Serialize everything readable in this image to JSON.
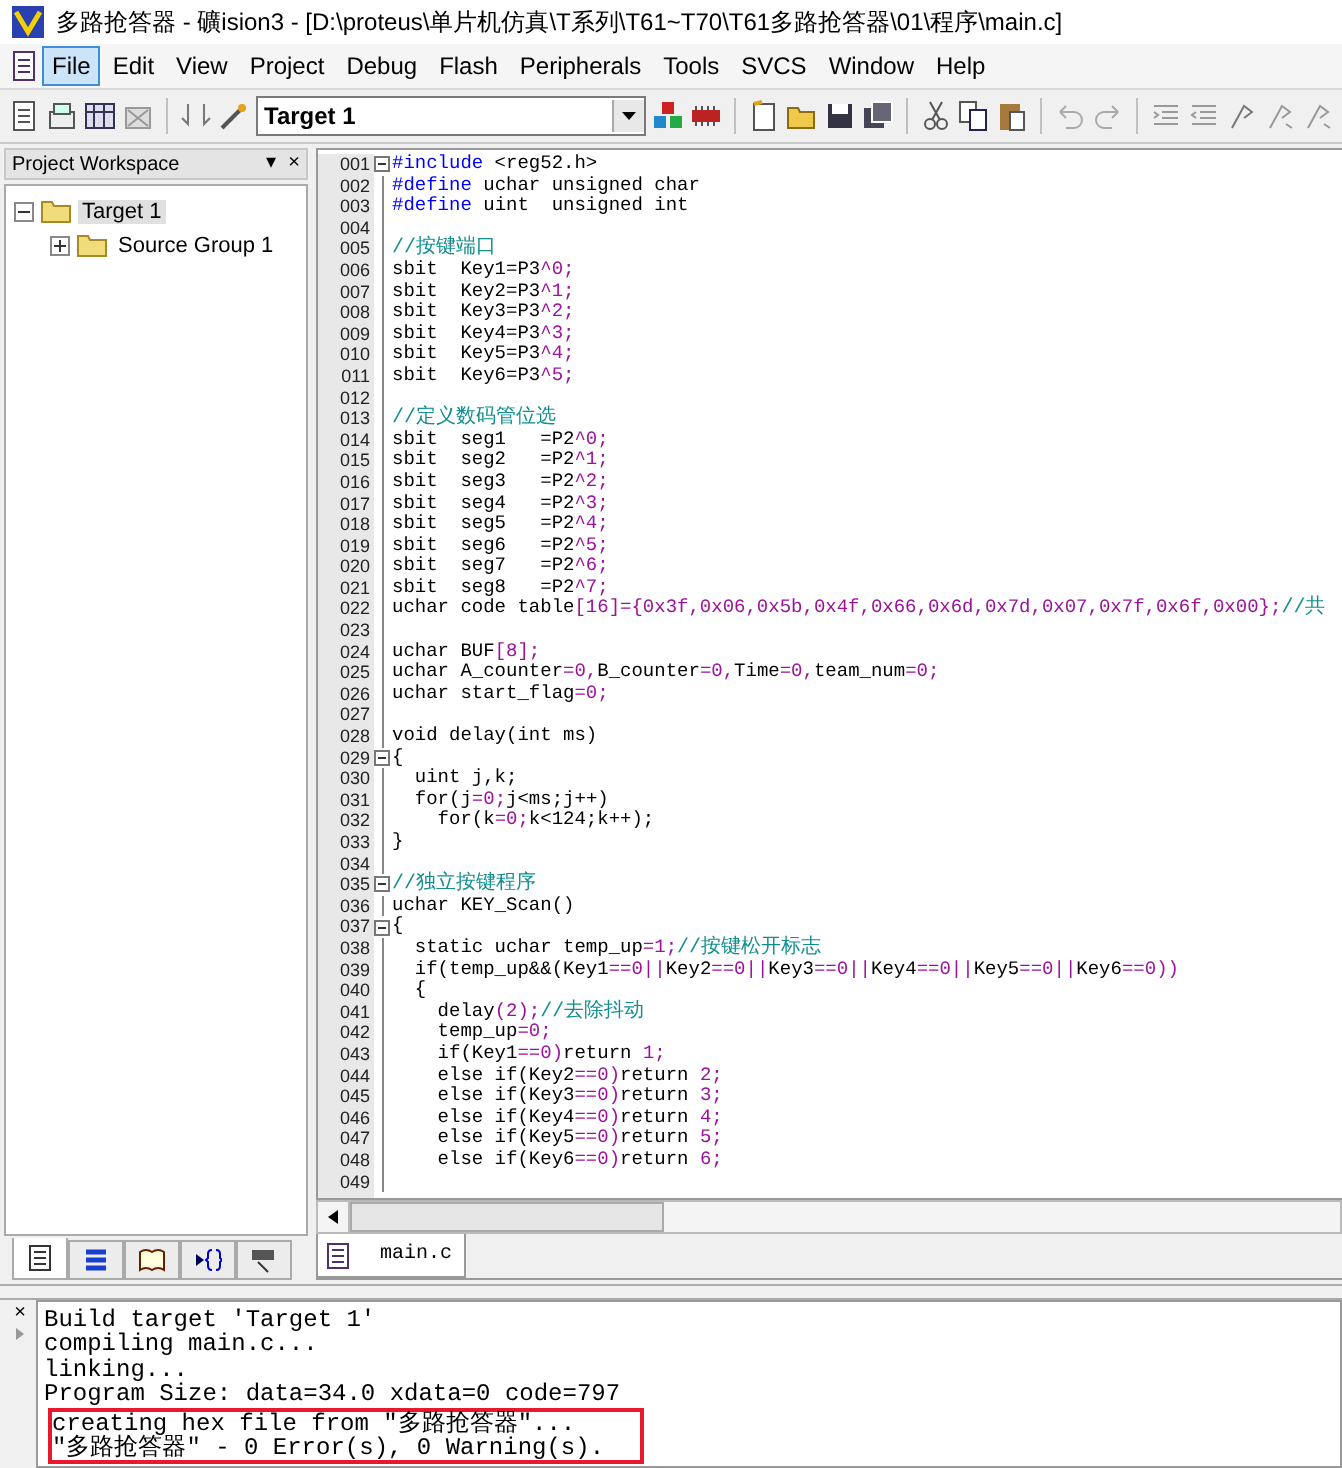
{
  "window": {
    "title": "多路抢答器  - 礦ision3 - [D:\\proteus\\单片机仿真\\T系列\\T61~T70\\T61多路抢答器\\01\\程序\\main.c]"
  },
  "menu": [
    {
      "label": "File",
      "selected": true
    },
    {
      "label": "Edit",
      "selected": false
    },
    {
      "label": "View",
      "selected": false
    },
    {
      "label": "Project",
      "selected": false
    },
    {
      "label": "Debug",
      "selected": false
    },
    {
      "label": "Flash",
      "selected": false
    },
    {
      "label": "Peripherals",
      "selected": false
    },
    {
      "label": "Tools",
      "selected": false
    },
    {
      "label": "SVCS",
      "selected": false
    },
    {
      "label": "Window",
      "selected": false
    },
    {
      "label": "Help",
      "selected": false
    }
  ],
  "toolbar": {
    "target": "Target 1"
  },
  "workspace": {
    "title": "Project Workspace",
    "menu_glyph": "▾",
    "close_glyph": "×",
    "tree": [
      {
        "label": "Target 1",
        "selected": true,
        "expanded": true,
        "children": [
          {
            "label": "Source Group 1",
            "selected": false,
            "expanded": false
          }
        ]
      }
    ],
    "tabs": [
      {
        "selected": true
      },
      {
        "selected": false
      },
      {
        "selected": false
      },
      {
        "selected": false
      },
      {
        "selected": false
      }
    ]
  },
  "editor": {
    "lines": [
      {
        "n": "001",
        "fold": true,
        "segs": [
          {
            "text": "#include",
            "kind": "kw"
          },
          {
            "text": " <reg52.h>",
            "kind": "plain"
          }
        ]
      },
      {
        "n": "002",
        "fold": false,
        "segs": [
          {
            "text": "#define",
            "kind": "kw"
          },
          {
            "text": " uchar unsigned char",
            "kind": "plain"
          }
        ]
      },
      {
        "n": "003",
        "fold": false,
        "segs": [
          {
            "text": "#define",
            "kind": "kw"
          },
          {
            "text": " uint  unsigned int",
            "kind": "plain"
          }
        ]
      },
      {
        "n": "004",
        "fold": false
      },
      {
        "n": "005",
        "fold": false,
        "segs": [
          {
            "text": "//按键端口",
            "kind": "comment"
          }
        ]
      },
      {
        "n": "006",
        "fold": false,
        "segs": [
          {
            "text": "sbit  Key1=P3",
            "kind": "plain"
          },
          {
            "text": "^0;",
            "kind": "num"
          }
        ]
      },
      {
        "n": "007",
        "fold": false,
        "segs": [
          {
            "text": "sbit  Key2=P3",
            "kind": "plain"
          },
          {
            "text": "^1;",
            "kind": "num"
          }
        ]
      },
      {
        "n": "008",
        "fold": false,
        "segs": [
          {
            "text": "sbit  Key3=P3",
            "kind": "plain"
          },
          {
            "text": "^2;",
            "kind": "num"
          }
        ]
      },
      {
        "n": "009",
        "fold": false,
        "segs": [
          {
            "text": "sbit  Key4=P3",
            "kind": "plain"
          },
          {
            "text": "^3;",
            "kind": "num"
          }
        ]
      },
      {
        "n": "010",
        "fold": false,
        "segs": [
          {
            "text": "sbit  Key5=P3",
            "kind": "plain"
          },
          {
            "text": "^4;",
            "kind": "num"
          }
        ]
      },
      {
        "n": "011",
        "fold": false,
        "segs": [
          {
            "text": "sbit  Key6=P3",
            "kind": "plain"
          },
          {
            "text": "^5;",
            "kind": "num"
          }
        ]
      },
      {
        "n": "012",
        "fold": false
      },
      {
        "n": "013",
        "fold": false,
        "segs": [
          {
            "text": "//定义数码管位选",
            "kind": "comment"
          }
        ]
      },
      {
        "n": "014",
        "fold": false,
        "segs": [
          {
            "text": "sbit  seg1   =P2",
            "kind": "plain"
          },
          {
            "text": "^0;",
            "kind": "num"
          }
        ]
      },
      {
        "n": "015",
        "fold": false,
        "segs": [
          {
            "text": "sbit  seg2   =P2",
            "kind": "plain"
          },
          {
            "text": "^1;",
            "kind": "num"
          }
        ]
      },
      {
        "n": "016",
        "fold": false,
        "segs": [
          {
            "text": "sbit  seg3   =P2",
            "kind": "plain"
          },
          {
            "text": "^2;",
            "kind": "num"
          }
        ]
      },
      {
        "n": "017",
        "fold": false,
        "segs": [
          {
            "text": "sbit  seg4   =P2",
            "kind": "plain"
          },
          {
            "text": "^3;",
            "kind": "num"
          }
        ]
      },
      {
        "n": "018",
        "fold": false,
        "segs": [
          {
            "text": "sbit  seg5   =P2",
            "kind": "plain"
          },
          {
            "text": "^4;",
            "kind": "num"
          }
        ]
      },
      {
        "n": "019",
        "fold": false,
        "segs": [
          {
            "text": "sbit  seg6   =P2",
            "kind": "plain"
          },
          {
            "text": "^5;",
            "kind": "num"
          }
        ]
      },
      {
        "n": "020",
        "fold": false,
        "segs": [
          {
            "text": "sbit  seg7   =P2",
            "kind": "plain"
          },
          {
            "text": "^6;",
            "kind": "num"
          }
        ]
      },
      {
        "n": "021",
        "fold": false,
        "segs": [
          {
            "text": "sbit  seg8   =P2",
            "kind": "plain"
          },
          {
            "text": "^7;",
            "kind": "num"
          }
        ]
      },
      {
        "n": "022",
        "fold": false,
        "segs": [
          {
            "text": "uchar code table",
            "kind": "plain"
          },
          {
            "text": "[16]={0x3f,0x06,0x5b,0x4f,0x66,0x6d,0x7d,0x07,0x7f,0x6f,0x00};",
            "kind": "num"
          },
          {
            "text": "//共",
            "kind": "comment"
          }
        ]
      },
      {
        "n": "023",
        "fold": false
      },
      {
        "n": "024",
        "fold": false,
        "segs": [
          {
            "text": "uchar BUF",
            "kind": "plain"
          },
          {
            "text": "[8];",
            "kind": "num"
          }
        ]
      },
      {
        "n": "025",
        "fold": false,
        "segs": [
          {
            "text": "uchar A_counter",
            "kind": "plain"
          },
          {
            "text": "=0,",
            "kind": "num"
          },
          {
            "text": "B_counter",
            "kind": "plain"
          },
          {
            "text": "=0,",
            "kind": "num"
          },
          {
            "text": "Time",
            "kind": "plain"
          },
          {
            "text": "=0,",
            "kind": "num"
          },
          {
            "text": "team_num",
            "kind": "plain"
          },
          {
            "text": "=0;",
            "kind": "num"
          }
        ]
      },
      {
        "n": "026",
        "fold": false,
        "segs": [
          {
            "text": "uchar start_flag",
            "kind": "plain"
          },
          {
            "text": "=0;",
            "kind": "num"
          }
        ]
      },
      {
        "n": "027",
        "fold": false
      },
      {
        "n": "028",
        "fold": false,
        "segs": [
          {
            "text": "void delay(int ms)",
            "kind": "plain"
          }
        ]
      },
      {
        "n": "029",
        "fold": true,
        "segs": [
          {
            "text": "{",
            "kind": "plain"
          }
        ]
      },
      {
        "n": "030",
        "fold": false,
        "segs": [
          {
            "text": "  uint j,k;",
            "kind": "plain"
          }
        ]
      },
      {
        "n": "031",
        "fold": false,
        "segs": [
          {
            "text": "  for(j",
            "kind": "plain"
          },
          {
            "text": "=0;",
            "kind": "num"
          },
          {
            "text": "j<ms;j++)",
            "kind": "plain"
          }
        ]
      },
      {
        "n": "032",
        "fold": false,
        "segs": [
          {
            "text": "    for(k",
            "kind": "plain"
          },
          {
            "text": "=0;",
            "kind": "num"
          },
          {
            "text": "k<124;k++);",
            "kind": "plain"
          }
        ]
      },
      {
        "n": "033",
        "fold": false,
        "segs": [
          {
            "text": "}",
            "kind": "plain"
          }
        ]
      },
      {
        "n": "034",
        "fold": false
      },
      {
        "n": "035",
        "fold": true,
        "segs": [
          {
            "text": "//独立按键程序",
            "kind": "comment"
          }
        ]
      },
      {
        "n": "036",
        "fold": false,
        "segs": [
          {
            "text": "uchar KEY_Scan()",
            "kind": "plain"
          }
        ]
      },
      {
        "n": "037",
        "fold": true,
        "segs": [
          {
            "text": "{",
            "kind": "plain"
          }
        ]
      },
      {
        "n": "038",
        "fold": false,
        "segs": [
          {
            "text": "  static uchar temp_up",
            "kind": "plain"
          },
          {
            "text": "=1;",
            "kind": "num"
          },
          {
            "text": "//按键松开标志",
            "kind": "comment"
          }
        ]
      },
      {
        "n": "039",
        "fold": false,
        "segs": [
          {
            "text": "  if(temp_up&&(Key1",
            "kind": "plain"
          },
          {
            "text": "==0||",
            "kind": "num"
          },
          {
            "text": "Key2",
            "kind": "plain"
          },
          {
            "text": "==0||",
            "kind": "num"
          },
          {
            "text": "Key3",
            "kind": "plain"
          },
          {
            "text": "==0||",
            "kind": "num"
          },
          {
            "text": "Key4",
            "kind": "plain"
          },
          {
            "text": "==0||",
            "kind": "num"
          },
          {
            "text": "Key5",
            "kind": "plain"
          },
          {
            "text": "==0||",
            "kind": "num"
          },
          {
            "text": "Key6",
            "kind": "plain"
          },
          {
            "text": "==0))",
            "kind": "num"
          }
        ]
      },
      {
        "n": "040",
        "fold": false,
        "segs": [
          {
            "text": "  {",
            "kind": "plain"
          }
        ]
      },
      {
        "n": "041",
        "fold": false,
        "segs": [
          {
            "text": "    delay",
            "kind": "plain"
          },
          {
            "text": "(2);",
            "kind": "num"
          },
          {
            "text": "//去除抖动",
            "kind": "comment"
          }
        ]
      },
      {
        "n": "042",
        "fold": false,
        "segs": [
          {
            "text": "    temp_up",
            "kind": "plain"
          },
          {
            "text": "=0;",
            "kind": "num"
          }
        ]
      },
      {
        "n": "043",
        "fold": false,
        "segs": [
          {
            "text": "    if(Key1",
            "kind": "plain"
          },
          {
            "text": "==0)",
            "kind": "num"
          },
          {
            "text": "return ",
            "kind": "plain"
          },
          {
            "text": "1;",
            "kind": "num"
          }
        ]
      },
      {
        "n": "044",
        "fold": false,
        "segs": [
          {
            "text": "    else if(Key2",
            "kind": "plain"
          },
          {
            "text": "==0)",
            "kind": "num"
          },
          {
            "text": "return ",
            "kind": "plain"
          },
          {
            "text": "2;",
            "kind": "num"
          }
        ]
      },
      {
        "n": "045",
        "fold": false,
        "segs": [
          {
            "text": "    else if(Key3",
            "kind": "plain"
          },
          {
            "text": "==0)",
            "kind": "num"
          },
          {
            "text": "return ",
            "kind": "plain"
          },
          {
            "text": "3;",
            "kind": "num"
          }
        ]
      },
      {
        "n": "046",
        "fold": false,
        "segs": [
          {
            "text": "    else if(Key4",
            "kind": "plain"
          },
          {
            "text": "==0)",
            "kind": "num"
          },
          {
            "text": "return ",
            "kind": "plain"
          },
          {
            "text": "4;",
            "kind": "num"
          }
        ]
      },
      {
        "n": "047",
        "fold": false,
        "segs": [
          {
            "text": "    else if(Key5",
            "kind": "plain"
          },
          {
            "text": "==0)",
            "kind": "num"
          },
          {
            "text": "return ",
            "kind": "plain"
          },
          {
            "text": "5;",
            "kind": "num"
          }
        ]
      },
      {
        "n": "048",
        "fold": false,
        "segs": [
          {
            "text": "    else if(Key6",
            "kind": "plain"
          },
          {
            "text": "==0)",
            "kind": "num"
          },
          {
            "text": "return ",
            "kind": "plain"
          },
          {
            "text": "6;",
            "kind": "num"
          }
        ]
      },
      {
        "n": "049",
        "fold": false
      }
    ],
    "tabs": [
      {
        "label": "main.c",
        "selected": true
      }
    ]
  },
  "output": {
    "close_glyph": "×",
    "lines": [
      {
        "text": "Build target 'Target 1'",
        "boxed": false
      },
      {
        "text": "compiling main.c...",
        "boxed": false
      },
      {
        "text": "linking...",
        "boxed": false
      },
      {
        "text": "Program Size: data=34.0 xdata=0 code=797",
        "boxed": false
      },
      {
        "text": "creating hex file from \"多路抢答器\"...",
        "boxed": true
      },
      {
        "text": "\"多路抢答器\" - 0 Error(s), 0 Warning(s).",
        "boxed": true
      }
    ]
  }
}
